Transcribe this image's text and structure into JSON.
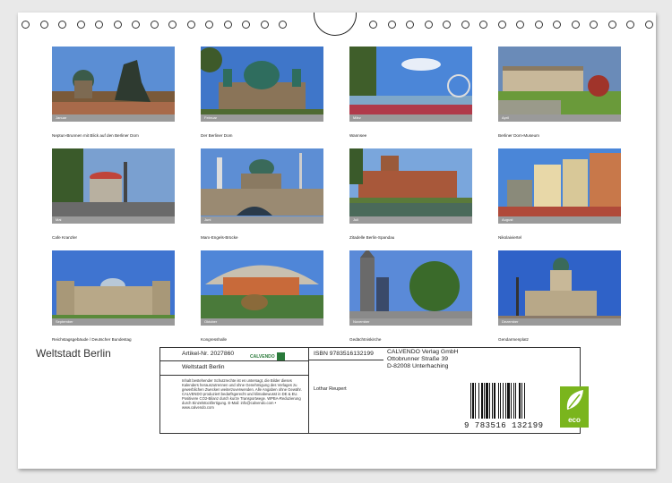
{
  "calendar_title": "Weltstadt Berlin",
  "photos": [
    {
      "strip": "Januar",
      "caption": "Neptun-Brunnen mit Blick auf den Berliner Dom"
    },
    {
      "strip": "Februar",
      "caption": "Der Berliner Dom"
    },
    {
      "strip": "März",
      "caption": "Wannsee"
    },
    {
      "strip": "April",
      "caption": "Berliner Dom-Museum"
    },
    {
      "strip": "Mai",
      "caption": "Cafe Kranzler"
    },
    {
      "strip": "Juni",
      "caption": "Marx-Engels-Brücke"
    },
    {
      "strip": "Juli",
      "caption": "Zitadelle Berlin-Spandau"
    },
    {
      "strip": "August",
      "caption": "Nikolaiviertel"
    },
    {
      "strip": "September",
      "caption": "Reichstagsgebäude / Deutscher Bundestag"
    },
    {
      "strip": "Oktober",
      "caption": "Kongresshalle"
    },
    {
      "strip": "November",
      "caption": "Gedächtniskirche"
    },
    {
      "strip": "Dezember",
      "caption": "Gendarmenplatz"
    }
  ],
  "info": {
    "article": "Artikel-Nr. 2027860",
    "brand": "CALVENDO",
    "title": "Weltstadt Berlin",
    "isbn": "ISBN 9783516132199",
    "author": "Lothar Reupert",
    "publisher": "CALVENDO Verlag GmbH",
    "street": "Ottobrunner Straße 39",
    "city": "D-82008 Unterhaching",
    "legal": "Inhalt bestehender Schutzrechte ist es untersagt, die Bilder dieses Kalenders herauszutrennen und ohne Genehmigung des Verlages zu gewerblichen Zwecken weiterzuverwenden. Alle Angaben ohne Gewähr. CALVENDO produziert bedarfsgerecht und klimabewusst in DE & EU. Positivere CO2-Bilanz durch kurze Transportwege. WPBA-Reduzierung durch Einzelstückfertigung. E-Mail: info@calvendo.com • www.calvendo.com"
  },
  "barcode_number": "9 783516 132199",
  "eco_label": "eco"
}
